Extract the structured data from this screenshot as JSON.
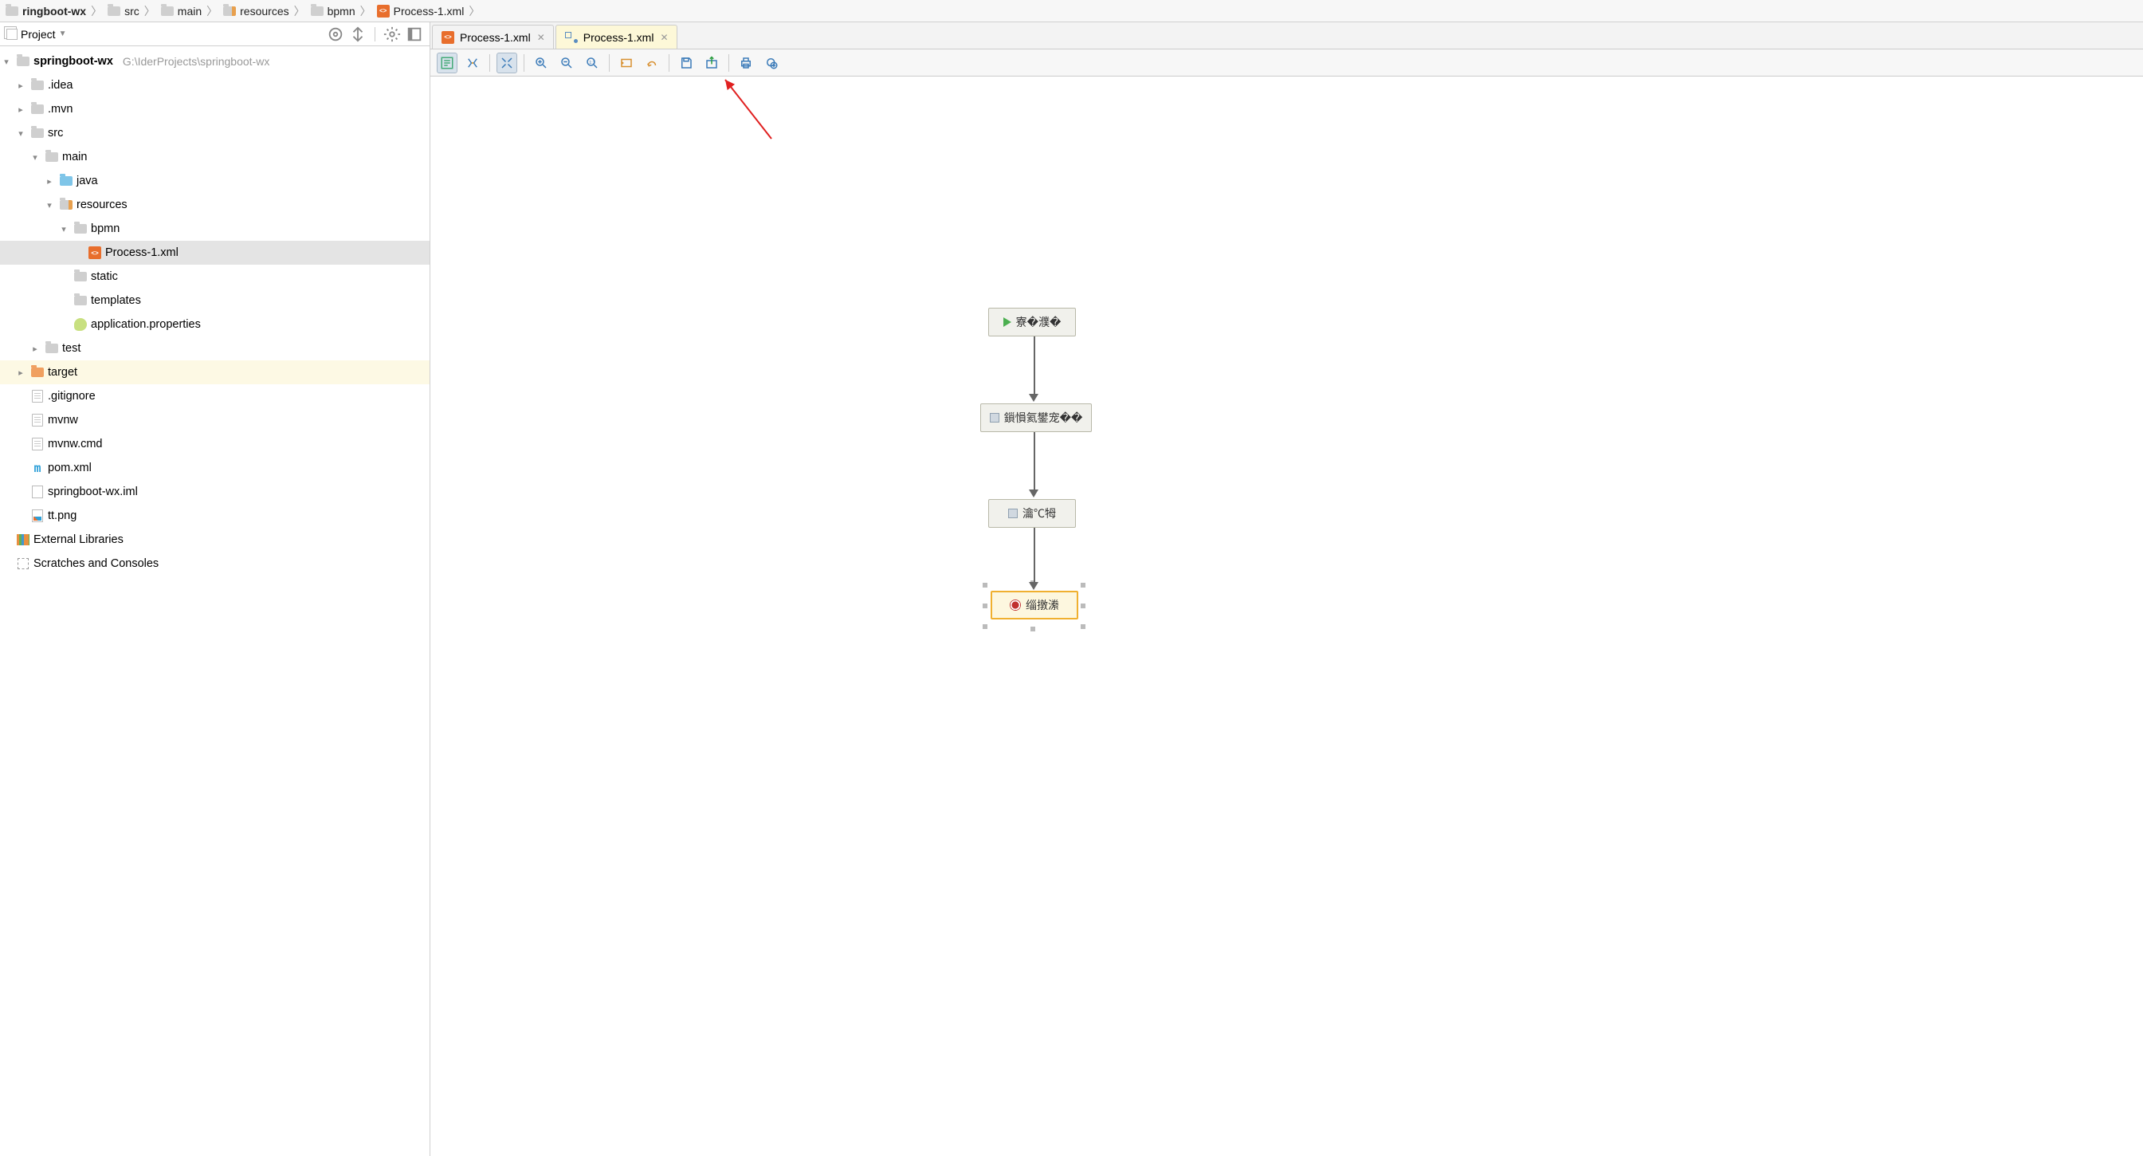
{
  "breadcrumb": [
    {
      "icon": "folder-grey",
      "label": "ringboot-wx"
    },
    {
      "icon": "folder-grey",
      "label": "src"
    },
    {
      "icon": "folder-grey",
      "label": "main"
    },
    {
      "icon": "folder-res",
      "label": "resources"
    },
    {
      "icon": "folder-grey",
      "label": "bpmn"
    },
    {
      "icon": "xml",
      "label": "Process-1.xml"
    }
  ],
  "project_toolwindow": {
    "title": "Project",
    "actions": [
      "locate",
      "collapse",
      "settings",
      "hide"
    ]
  },
  "project_tree": {
    "root": {
      "name": "springboot-wx",
      "path": "G:\\IderProjects\\springboot-wx"
    },
    "nodes": [
      {
        "name": ".idea",
        "icon": "folder-grey",
        "indent": 1,
        "arrow": ">"
      },
      {
        "name": ".mvn",
        "icon": "folder-grey",
        "indent": 1,
        "arrow": ">"
      },
      {
        "name": "src",
        "icon": "folder-grey",
        "indent": 1,
        "arrow": "v"
      },
      {
        "name": "main",
        "icon": "folder-grey",
        "indent": 2,
        "arrow": "v"
      },
      {
        "name": "java",
        "icon": "folder-blue",
        "indent": 3,
        "arrow": ">"
      },
      {
        "name": "resources",
        "icon": "folder-res",
        "indent": 3,
        "arrow": "v"
      },
      {
        "name": "bpmn",
        "icon": "folder-grey",
        "indent": 4,
        "arrow": "v"
      },
      {
        "name": "Process-1.xml",
        "icon": "xml",
        "indent": 5,
        "arrow": "",
        "selected": true
      },
      {
        "name": "static",
        "icon": "folder-grey",
        "indent": 4,
        "arrow": ""
      },
      {
        "name": "templates",
        "icon": "folder-grey",
        "indent": 4,
        "arrow": ""
      },
      {
        "name": "application.properties",
        "icon": "prop",
        "indent": 4,
        "arrow": ""
      },
      {
        "name": "test",
        "icon": "folder-grey",
        "indent": 2,
        "arrow": ">"
      },
      {
        "name": "target",
        "icon": "folder-orange",
        "indent": 1,
        "arrow": ">",
        "yellow": true
      },
      {
        "name": ".gitignore",
        "icon": "file",
        "indent": 1,
        "arrow": ""
      },
      {
        "name": "mvnw",
        "icon": "file",
        "indent": 1,
        "arrow": ""
      },
      {
        "name": "mvnw.cmd",
        "icon": "file",
        "indent": 1,
        "arrow": ""
      },
      {
        "name": "pom.xml",
        "icon": "m",
        "indent": 1,
        "arrow": ""
      },
      {
        "name": "springboot-wx.iml",
        "icon": "iml",
        "indent": 1,
        "arrow": ""
      },
      {
        "name": "tt.png",
        "icon": "png",
        "indent": 1,
        "arrow": ""
      }
    ],
    "extras": [
      {
        "name": "External Libraries",
        "icon": "lib"
      },
      {
        "name": "Scratches and Consoles",
        "icon": "scratch"
      }
    ]
  },
  "editor_tabs": [
    {
      "label": "Process-1.xml",
      "icon": "xml",
      "active": false
    },
    {
      "label": "Process-1.xml",
      "icon": "bpmn",
      "active": true
    }
  ],
  "editor_toolbar_buttons": [
    "properties-icon",
    "magic-layout-icon",
    "sep",
    "fit-icon",
    "sep",
    "zoom-in-icon",
    "zoom-out-icon",
    "zoom-actual-icon",
    "sep",
    "undo-icon",
    "redo-icon",
    "sep",
    "save-icon",
    "export-image-icon",
    "sep",
    "print-icon",
    "deploy-icon"
  ],
  "bpmn_diagram": {
    "nodes": [
      {
        "id": "start",
        "type": "start",
        "label": "寮�濮�"
      },
      {
        "id": "task1",
        "type": "task",
        "label": "鎻愪氦鐢宠��"
      },
      {
        "id": "task2",
        "type": "task",
        "label": "瀹℃牳"
      },
      {
        "id": "end",
        "type": "end",
        "label": "缁撴潫",
        "selected": true
      }
    ],
    "edges": [
      [
        "start",
        "task1"
      ],
      [
        "task1",
        "task2"
      ],
      [
        "task2",
        "end"
      ]
    ]
  }
}
